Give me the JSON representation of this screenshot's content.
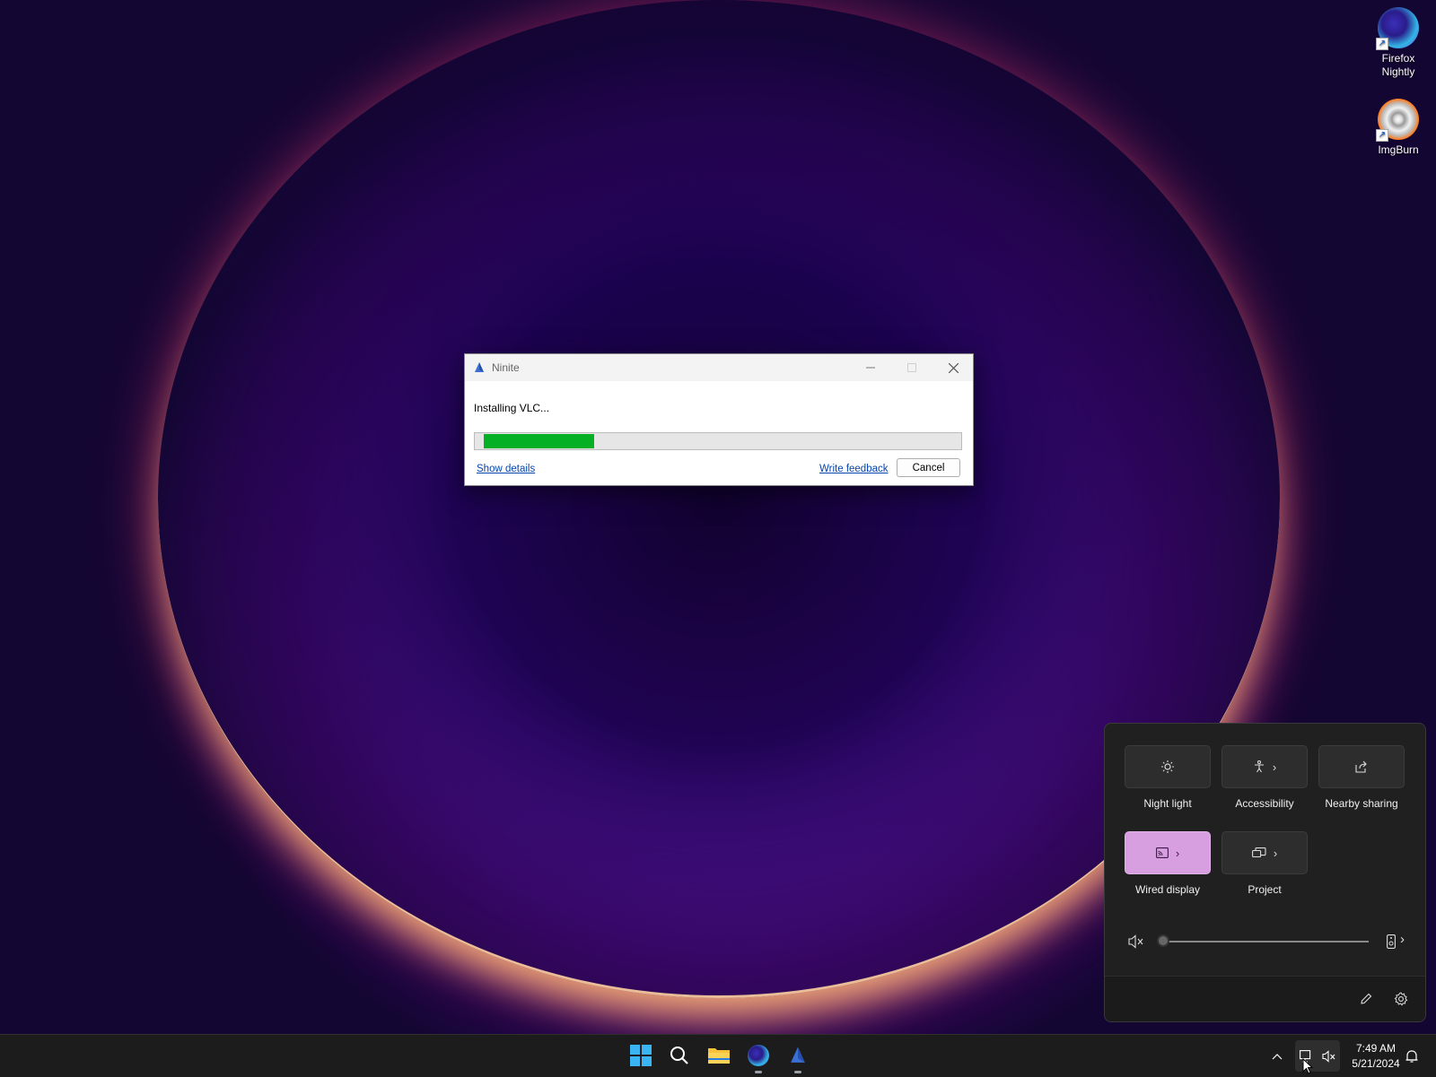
{
  "desktop": {
    "icons": [
      {
        "label": "Firefox Nightly",
        "icon": "firefox-nightly-icon"
      },
      {
        "label": "ImgBurn",
        "icon": "imgburn-icon"
      }
    ]
  },
  "dialog": {
    "title": "Ninite",
    "status": "Installing VLC...",
    "progress_percent": 23,
    "show_details": "Show details",
    "write_feedback": "Write feedback",
    "cancel": "Cancel"
  },
  "quick_settings": {
    "tiles": [
      {
        "label": "Night light",
        "icon": "brightness-icon",
        "active": false,
        "has_chevron": false
      },
      {
        "label": "Accessibility",
        "icon": "accessibility-icon",
        "active": false,
        "has_chevron": true
      },
      {
        "label": "Nearby sharing",
        "icon": "share-icon",
        "active": false,
        "has_chevron": false
      },
      {
        "label": "Wired display",
        "icon": "cast-icon",
        "active": true,
        "has_chevron": true
      },
      {
        "label": "Project",
        "icon": "project-icon",
        "active": false,
        "has_chevron": true
      }
    ],
    "volume_percent": 0,
    "accent_color": "#d79fe0"
  },
  "taskbar": {
    "apps": [
      "start-icon",
      "search-icon",
      "file-explorer-icon",
      "firefox-nightly-icon",
      "ninite-icon"
    ],
    "time": "7:49 AM",
    "date": "5/21/2024"
  }
}
